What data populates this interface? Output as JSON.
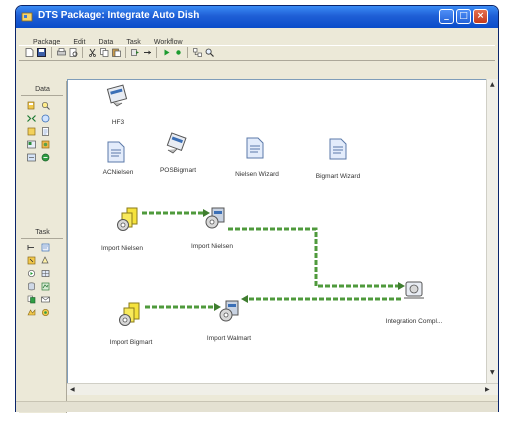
{
  "window": {
    "title": "DTS Package: Integrate Auto Dish"
  },
  "menu": [
    "Package",
    "Edit",
    "Data",
    "Task",
    "Workflow"
  ],
  "palette": {
    "data_label": "Data",
    "task_label": "Task"
  },
  "canvas": {
    "objects": [
      {
        "id": "hf3",
        "label": "HF3",
        "icon": "connection-icon"
      },
      {
        "id": "acnielsen",
        "label": "ACNielsen",
        "icon": "text-file-icon"
      },
      {
        "id": "posbigmart",
        "label": "POSBigmart",
        "icon": "connection-icon"
      },
      {
        "id": "nielsen-wizard",
        "label": "Nielsen Wizard",
        "icon": "text-file-icon"
      },
      {
        "id": "bigmart-wizard",
        "label": "Bigmart Wizard",
        "icon": "text-file-icon"
      },
      {
        "id": "import-nielsen-1",
        "label": "Import Nielsen",
        "icon": "package-task-icon"
      },
      {
        "id": "import-nielsen-2",
        "label": "Import Nielsen",
        "icon": "transform-task-icon"
      },
      {
        "id": "integration",
        "label": "Integration Compl...",
        "icon": "integration-task-icon"
      },
      {
        "id": "import-bigmart",
        "label": "Import Bigmart",
        "icon": "package-task-icon"
      },
      {
        "id": "import-walmart",
        "label": "Import Walmart",
        "icon": "transform-task-icon"
      }
    ]
  },
  "colors": {
    "titlebar": "#1f5fd6",
    "workflow_arrow": "#4f9a3c"
  }
}
